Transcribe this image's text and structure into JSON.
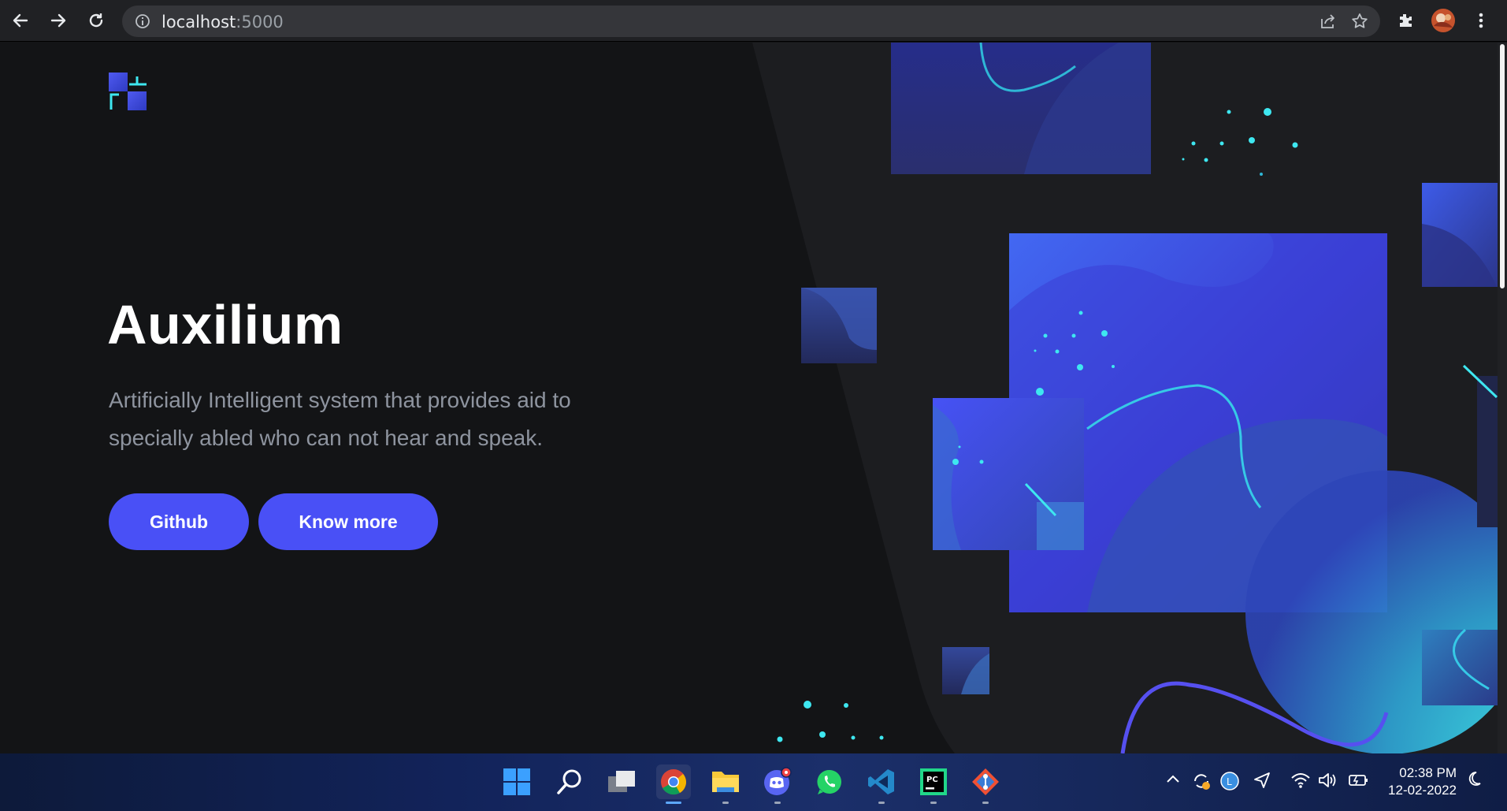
{
  "browser": {
    "url_host": "localhost",
    "url_port": ":5000",
    "icons": [
      "back-arrow-icon",
      "forward-arrow-icon",
      "reload-icon",
      "site-info-icon",
      "share-icon",
      "bookmark-star-icon",
      "extensions-icon",
      "profile-avatar",
      "menu-kebab-icon"
    ]
  },
  "hero": {
    "title": "Auxilium",
    "subtitle": "Artificially Intelligent system that provides aid to specially abled who can not hear and speak.",
    "buttons": {
      "github": "Github",
      "know_more": "Know more"
    }
  },
  "colors": {
    "accent": "#4950f6",
    "cyan": "#3ee7f0",
    "page_bg": "#131416"
  },
  "taskbar": {
    "apps": [
      "start-icon",
      "search-icon",
      "task-view-icon",
      "chrome-icon",
      "file-explorer-icon",
      "discord-icon",
      "whatsapp-icon",
      "vscode-icon",
      "pycharm-icon",
      "git-icon"
    ],
    "time": "02:38 PM",
    "date": "12-02-2022"
  }
}
